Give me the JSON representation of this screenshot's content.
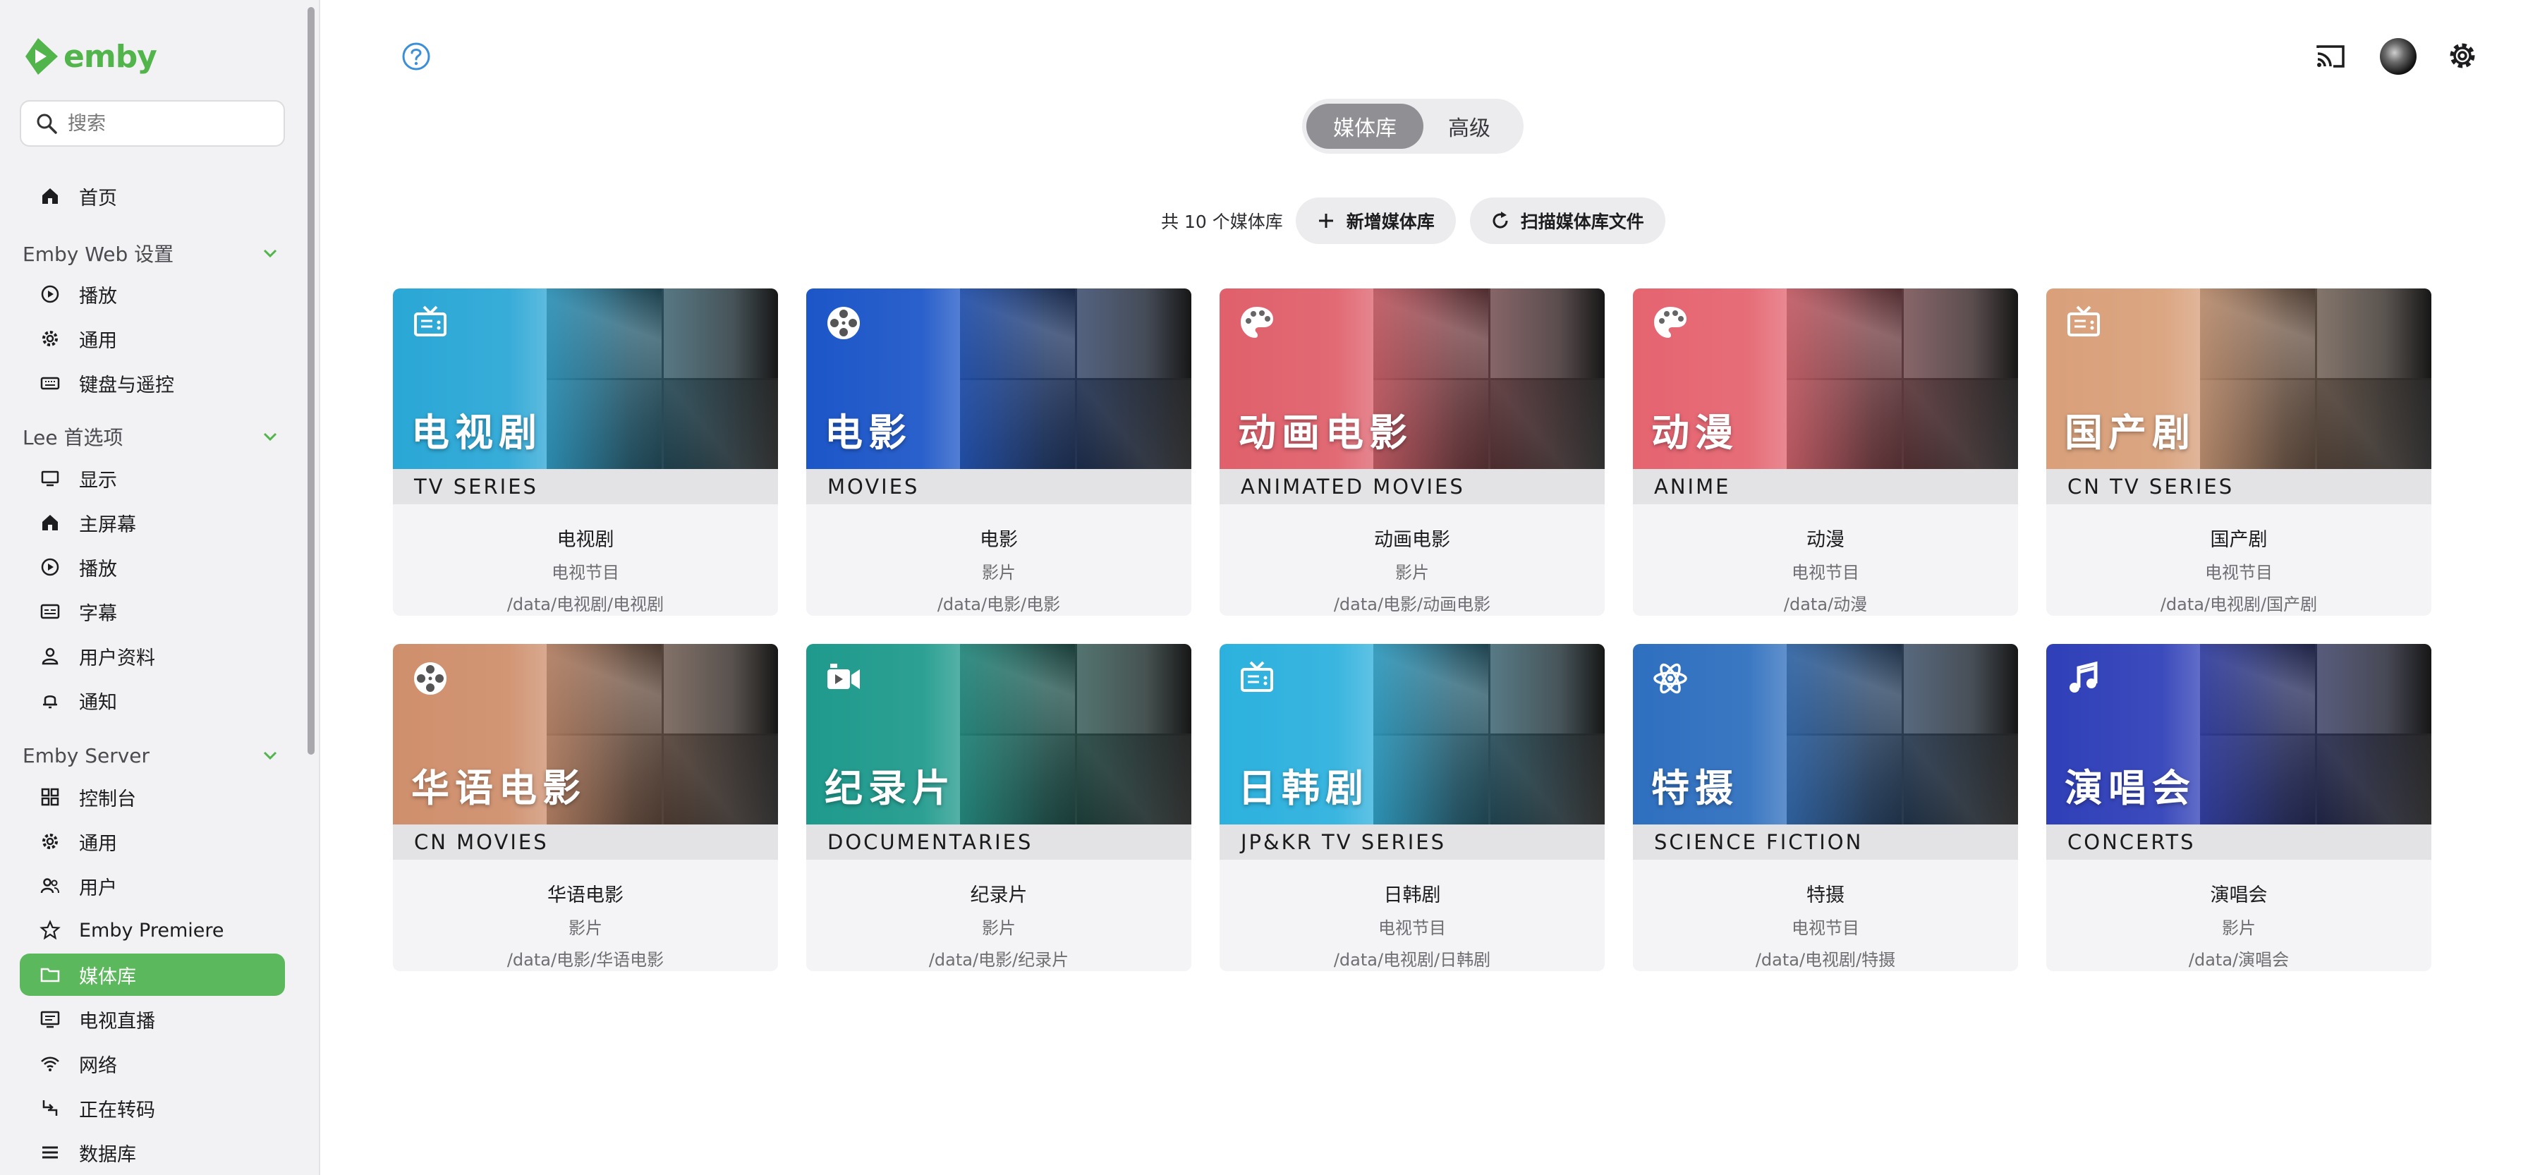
{
  "app": {
    "logo_text": "emby",
    "accent": "#52b54b"
  },
  "search": {
    "placeholder": "搜索"
  },
  "sidebar": {
    "home": "首页",
    "sections": [
      {
        "title": "Emby Web 设置",
        "items": [
          "播放",
          "通用",
          "键盘与遥控"
        ]
      },
      {
        "title": "Lee 首选项",
        "items": [
          "显示",
          "主屏幕",
          "播放",
          "字幕",
          "用户资料",
          "通知"
        ]
      },
      {
        "title": "Emby Server",
        "items": [
          "控制台",
          "通用",
          "用户",
          "Emby Premiere",
          "媒体库",
          "电视直播",
          "网络",
          "正在转码",
          "数据库"
        ]
      }
    ],
    "active_item": "媒体库"
  },
  "header": {
    "tabs": [
      {
        "label": "媒体库",
        "active": true
      },
      {
        "label": "高级",
        "active": false
      }
    ]
  },
  "toolbar": {
    "count_label": "共 10 个媒体库",
    "add_label": "新增媒体库",
    "scan_label": "扫描媒体库文件"
  },
  "libraries": [
    {
      "big": "电视剧",
      "band": "TV SERIES",
      "name": "电视剧",
      "type": "电视节目",
      "path": "/data/电视剧/电视剧",
      "icon": "tv-icon",
      "color": "#2aa7d6"
    },
    {
      "big": "电影",
      "band": "MOVIES",
      "name": "电影",
      "type": "影片",
      "path": "/data/电影/电影",
      "icon": "film-reel-icon",
      "color": "#1c56c8"
    },
    {
      "big": "动画电影",
      "band": "ANIMATED MOVIES",
      "name": "动画电影",
      "type": "影片",
      "path": "/data/电影/动画电影",
      "icon": "palette-icon",
      "color": "#e0606b"
    },
    {
      "big": "动漫",
      "band": "ANIME",
      "name": "动漫",
      "type": "电视节目",
      "path": "/data/动漫",
      "icon": "palette-icon",
      "color": "#e56470"
    },
    {
      "big": "国产剧",
      "band": "CN TV SERIES",
      "name": "国产剧",
      "type": "电视节目",
      "path": "/data/电视剧/国产剧",
      "icon": "tv-icon",
      "color": "#d9a07a"
    },
    {
      "big": "华语电影",
      "band": "CN MOVIES",
      "name": "华语电影",
      "type": "影片",
      "path": "/data/电影/华语电影",
      "icon": "film-reel-icon",
      "color": "#cf8f6c"
    },
    {
      "big": "纪录片",
      "band": "DOCUMENTARIES",
      "name": "纪录片",
      "type": "影片",
      "path": "/data/电影/纪录片",
      "icon": "video-icon",
      "color": "#1e9a8c"
    },
    {
      "big": "日韩剧",
      "band": "JP&KR TV SERIES",
      "name": "日韩剧",
      "type": "电视节目",
      "path": "/data/电视剧/日韩剧",
      "icon": "tv-icon",
      "color": "#2cb1de"
    },
    {
      "big": "特摄",
      "band": "SCIENCE FICTION",
      "name": "特摄",
      "type": "电视节目",
      "path": "/data/电视剧/特摄",
      "icon": "atom-icon",
      "color": "#2e6fbf"
    },
    {
      "big": "演唱会",
      "band": "CONCERTS",
      "name": "演唱会",
      "type": "影片",
      "path": "/data/演唱会",
      "icon": "music-note-icon",
      "color": "#2f3fb8"
    }
  ]
}
